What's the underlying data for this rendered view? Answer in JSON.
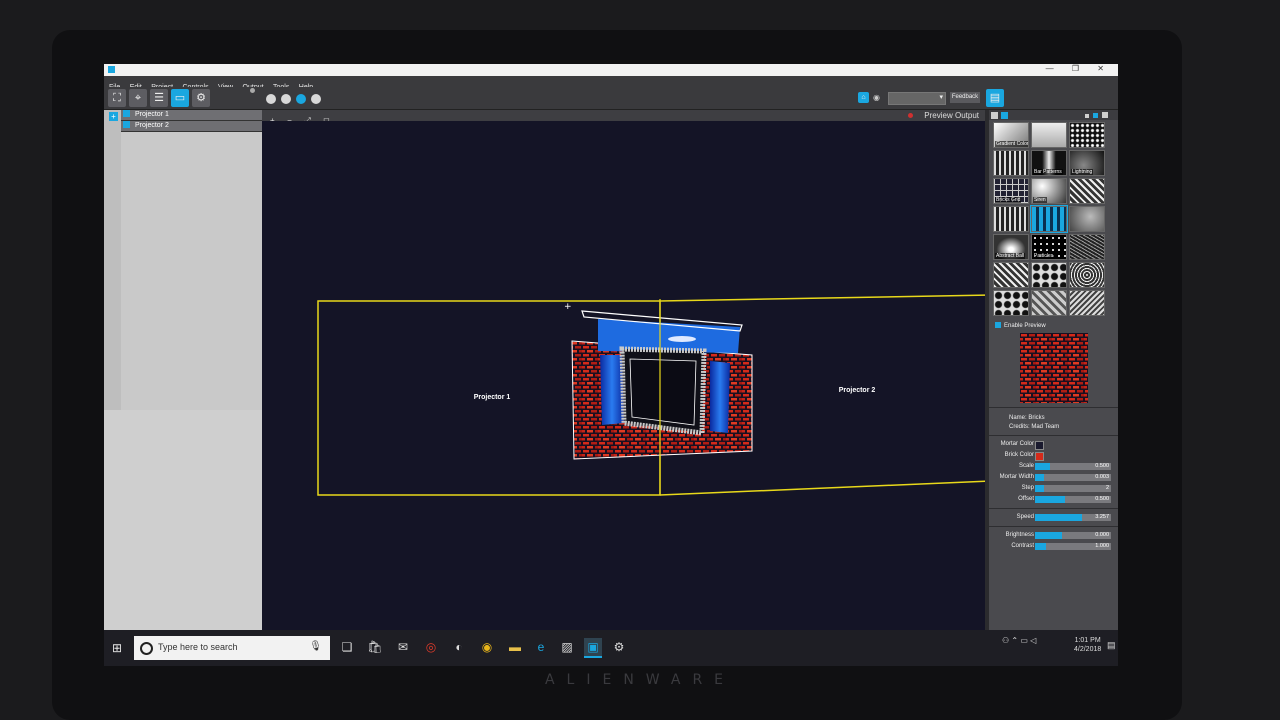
{
  "window": {
    "title_controls": "—  ❐  ✕"
  },
  "menu": [
    "File",
    "Edit",
    "Project",
    "Controls",
    "View",
    "Output",
    "Tools",
    "Help"
  ],
  "toolbar": {
    "feedback_label": "Feedback",
    "audio_select_value": ""
  },
  "projectors": [
    {
      "label": "Projector 1"
    },
    {
      "label": "Projector 2"
    }
  ],
  "canvas": {
    "tools": [
      "+",
      "−",
      "⤢",
      "◻"
    ],
    "preview_output_label": "Preview Output",
    "projector1_label": "Projector 1",
    "projector2_label": "Projector 2",
    "accent": "#e8d81a"
  },
  "library": {
    "thumbs": [
      {
        "label": "Gradient Color",
        "style": "grad"
      },
      {
        "label": "",
        "style": "light"
      },
      {
        "label": "",
        "style": "dots"
      },
      {
        "label": "",
        "style": "bars"
      },
      {
        "label": "Bar Patterns",
        "style": "beam"
      },
      {
        "label": "Lightning",
        "style": "dark"
      },
      {
        "label": "Bricks Grid",
        "style": "grid"
      },
      {
        "label": "Siren",
        "style": "siren"
      },
      {
        "label": "",
        "style": "stripes"
      },
      {
        "label": "",
        "style": "bars"
      },
      {
        "label": "",
        "style": "blue"
      },
      {
        "label": "",
        "style": "smoke"
      },
      {
        "label": "Abstract Ball",
        "style": "ball"
      },
      {
        "label": "Particles",
        "style": "stars"
      },
      {
        "label": "",
        "style": "noise"
      },
      {
        "label": "",
        "style": "stripes"
      },
      {
        "label": "",
        "style": "cells"
      },
      {
        "label": "",
        "style": "rings"
      },
      {
        "label": "",
        "style": "cells"
      },
      {
        "label": "",
        "style": "weave"
      },
      {
        "label": "",
        "style": "waves"
      }
    ]
  },
  "preview": {
    "enable_label": "Enable Preview",
    "name_label": "Name:",
    "name_value": "Bricks",
    "credits_label": "Credits:",
    "credits_value": "Mad Team"
  },
  "params": {
    "mortar_color": {
      "label": "Mortar Color",
      "color": "#1a1a2e"
    },
    "brick_color": {
      "label": "Brick Color",
      "color": "#d52a1a"
    },
    "scale": {
      "label": "Scale",
      "value": "0.500",
      "fraction": 0.2
    },
    "mortar_width": {
      "label": "Mortar Width",
      "value": "0.003",
      "fraction": 0.12
    },
    "step": {
      "label": "Step",
      "value": "2",
      "fraction": 0.12
    },
    "offset": {
      "label": "Offset",
      "value": "0.500",
      "fraction": 0.4
    },
    "speed": {
      "label": "Speed",
      "value": "3.257",
      "fraction": 0.62
    },
    "brightness": {
      "label": "Brightness",
      "value": "0.000",
      "fraction": 0.35
    },
    "contrast": {
      "label": "Contrast",
      "value": "1.000",
      "fraction": 0.15
    }
  },
  "taskbar": {
    "search_placeholder": "Type here to search",
    "time": "1:01 PM",
    "date": "4/2/2018"
  },
  "device": {
    "brand": "ALIENWARE"
  }
}
